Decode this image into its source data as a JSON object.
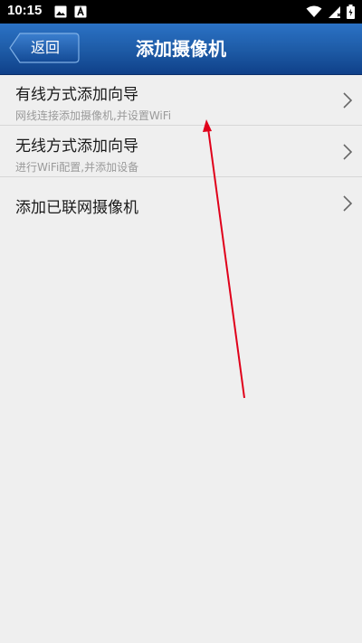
{
  "status_bar": {
    "time": "10:15",
    "icons_left": [
      "image-icon",
      "a-app-icon"
    ],
    "icons_right": [
      "wifi-icon",
      "signal-icon",
      "battery-icon"
    ]
  },
  "header": {
    "back_label": "返回",
    "title": "添加摄像机",
    "color": "#1d5aa5"
  },
  "list": {
    "items": [
      {
        "title": "有线方式添加向导",
        "subtitle": "网线连接添加摄像机,并设置WiFi"
      },
      {
        "title": "无线方式添加向导",
        "subtitle": "进行WiFi配置,并添加设备"
      },
      {
        "title": "添加已联网摄像机",
        "subtitle": ""
      }
    ]
  },
  "annotation": {
    "color": "#e0001a"
  }
}
